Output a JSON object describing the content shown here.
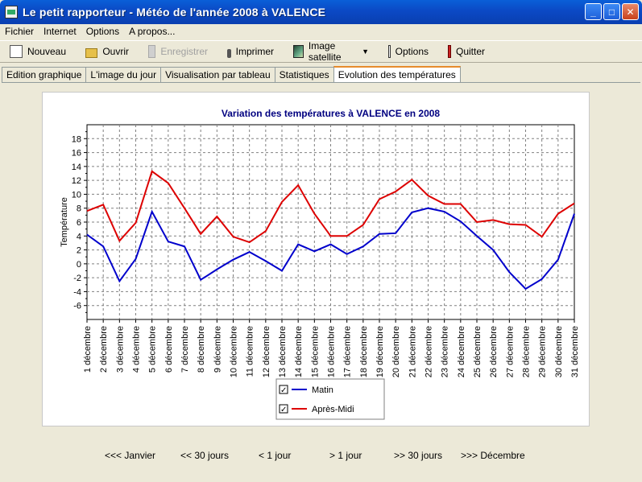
{
  "window": {
    "title": "Le petit rapporteur - Météo de l'année 2008 à VALENCE",
    "controls": [
      "_",
      "□",
      "✕"
    ]
  },
  "menu": [
    "Fichier",
    "Internet",
    "Options",
    "A propos..."
  ],
  "toolbar": {
    "new_label": "Nouveau",
    "open_label": "Ouvrir",
    "save_label": "Enregistrer",
    "print_label": "Imprimer",
    "satellite_label": "Image satellite",
    "options_label": "Options",
    "quit_label": "Quitter"
  },
  "tabs": [
    "Edition graphique",
    "L'image du jour",
    "Visualisation par tableau",
    "Statistiques",
    "Evolution des températures"
  ],
  "active_tab": 4,
  "navigation": {
    "first": "<<< Janvier",
    "back30": "<< 30 jours",
    "back1": "< 1 jour",
    "fwd1": "> 1 jour",
    "fwd30": ">> 30 jours",
    "last": ">>> Décembre"
  },
  "chart_data": {
    "type": "line",
    "title": "Variation des températures à VALENCE en 2008",
    "xlabel": "",
    "ylabel": "Température",
    "ylim": [
      -8,
      20
    ],
    "yticks": [
      -6,
      -4,
      -2,
      0,
      2,
      4,
      6,
      8,
      10,
      12,
      14,
      16,
      18
    ],
    "grid": true,
    "legend": "bottom",
    "categories": [
      "1 décembre",
      "2 décembre",
      "3 décembre",
      "4 décembre",
      "5 décembre",
      "6 décembre",
      "7 décembre",
      "8 décembre",
      "9 décembre",
      "10 décembre",
      "11 décembre",
      "12 décembre",
      "13 décembre",
      "14 décembre",
      "15 décembre",
      "16 décembre",
      "17 décembre",
      "18 décembre",
      "19 décembre",
      "20 décembre",
      "21 décembre",
      "22 décembre",
      "23 décembre",
      "24 décembre",
      "25 décembre",
      "26 décembre",
      "27 décembre",
      "28 décembre",
      "29 décembre",
      "30 décembre",
      "31 décembre"
    ],
    "series": [
      {
        "name": "Matin",
        "color": "#0000cc",
        "values": [
          4.2,
          2.5,
          -2.5,
          0.7,
          7.5,
          3.2,
          2.5,
          -2.3,
          -0.8,
          0.6,
          1.7,
          0.4,
          -1.0,
          2.8,
          1.8,
          2.8,
          1.4,
          2.5,
          4.3,
          4.4,
          7.4,
          8.0,
          7.5,
          6.1,
          4.0,
          2.0,
          -1.2,
          -3.6,
          -2.2,
          0.6,
          7.2
        ]
      },
      {
        "name": "Après-Midi",
        "color": "#dd0000",
        "values": [
          7.6,
          8.5,
          3.3,
          5.9,
          13.3,
          11.6,
          8.0,
          4.3,
          6.8,
          3.9,
          3.1,
          4.7,
          8.9,
          11.3,
          7.2,
          4.0,
          4.0,
          5.6,
          9.3,
          10.4,
          12.1,
          9.8,
          8.6,
          8.6,
          6.0,
          6.3,
          5.7,
          5.6,
          3.9,
          7.2,
          8.7
        ]
      }
    ]
  }
}
